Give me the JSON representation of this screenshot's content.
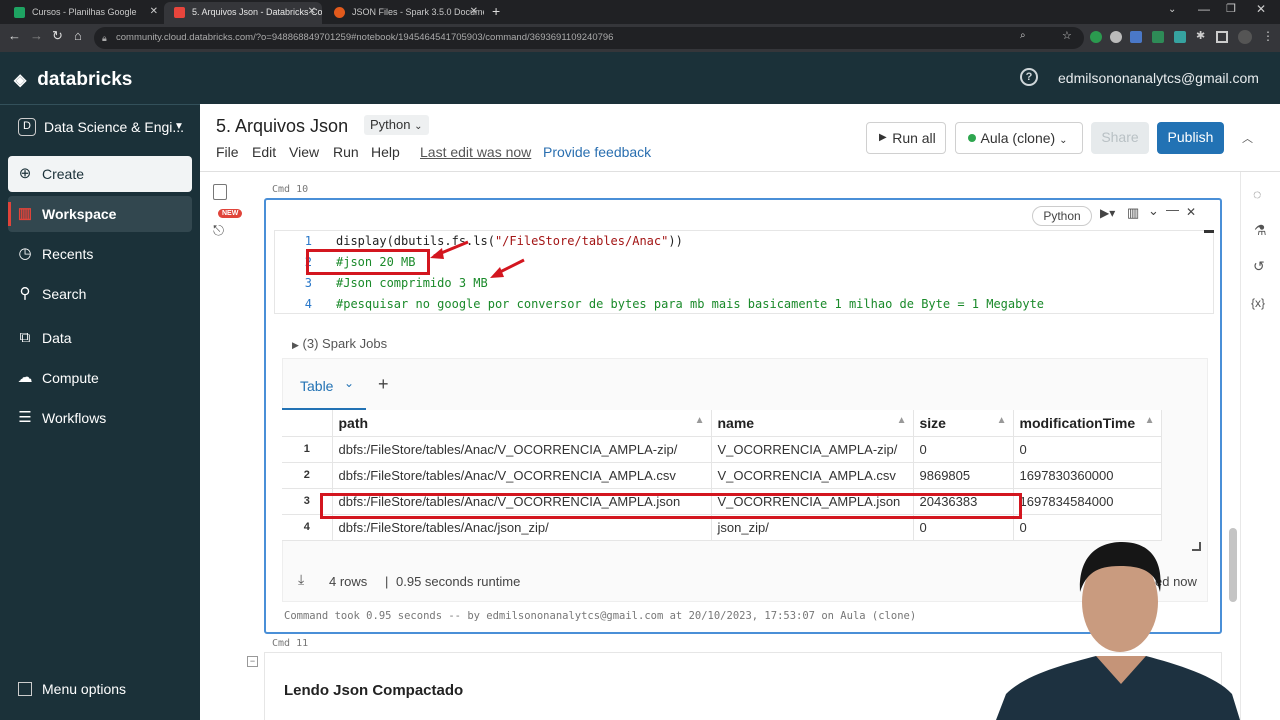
{
  "browser": {
    "tabs": [
      {
        "title": "Cursos - Planilhas Google",
        "fav_color": "#1ea362"
      },
      {
        "title": "5. Arquivos Json - Databricks Co",
        "fav_color": "#e8453c"
      },
      {
        "title": "JSON Files - Spark 3.5.0 Docume",
        "fav_color": "#e25a1c"
      }
    ],
    "url": "community.cloud.databricks.com/?o=948868849701259#notebook/1945464541705903/command/3693691109240796"
  },
  "app": {
    "brand": "databricks",
    "user_email": "edmilsononanalytcs@gmail.com",
    "workspace_switcher": "Data Science & Engi...",
    "create_label": "Create",
    "nav": [
      {
        "label": "Workspace",
        "icon": "workspace-icon"
      },
      {
        "label": "Recents",
        "icon": "clock-icon"
      },
      {
        "label": "Search",
        "icon": "search-icon"
      },
      {
        "label": "Data",
        "icon": "data-icon"
      },
      {
        "label": "Compute",
        "icon": "cloud-icon"
      },
      {
        "label": "Workflows",
        "icon": "workflows-icon"
      }
    ],
    "menu_options": "Menu options"
  },
  "notebook": {
    "title": "5. Arquivos Json",
    "language": "Python",
    "menu": [
      "File",
      "Edit",
      "View",
      "Run",
      "Help"
    ],
    "last_edit": "Last edit was now",
    "feedback": "Provide feedback",
    "run_all": "Run all",
    "cluster": "Aula (clone)",
    "share": "Share",
    "publish": "Publish",
    "new_badge": "NEW"
  },
  "cell10": {
    "cmd_label": "Cmd 10",
    "lang_badge": "Python",
    "line_numbers": [
      "1",
      "2",
      "3",
      "4"
    ],
    "code": {
      "fn": "display(dbutils.fs.ls(",
      "str": "\"/FileStore/tables/Anac\"",
      "close": "))",
      "c2": "#json 20 MB",
      "c3": "#Json comprimido 3 MB",
      "c4": "#pesquisar no google por conversor de bytes para mb mais basicamente 1 milhao de Byte = 1 Megabyte"
    },
    "spark_jobs": "(3) Spark Jobs",
    "result_tab": "Table",
    "table": {
      "columns": [
        "path",
        "name",
        "size",
        "modificationTime"
      ],
      "rows": [
        {
          "n": "1",
          "path": "dbfs:/FileStore/tables/Anac/V_OCORRENCIA_AMPLA-zip/",
          "name": "V_OCORRENCIA_AMPLA-zip/",
          "size": "0",
          "mod": "0"
        },
        {
          "n": "2",
          "path": "dbfs:/FileStore/tables/Anac/V_OCORRENCIA_AMPLA.csv",
          "name": "V_OCORRENCIA_AMPLA.csv",
          "size": "9869805",
          "mod": "1697830360000"
        },
        {
          "n": "3",
          "path": "dbfs:/FileStore/tables/Anac/V_OCORRENCIA_AMPLA.json",
          "name": "V_OCORRENCIA_AMPLA.json",
          "size": "20436383",
          "mod": "1697834584000"
        },
        {
          "n": "4",
          "path": "dbfs:/FileStore/tables/Anac/json_zip/",
          "name": "json_zip/",
          "size": "0",
          "mod": "0"
        }
      ]
    },
    "rows_count": "4 rows",
    "runtime": "0.95 seconds runtime",
    "refreshed": "ed now",
    "command_took": "Command took 0.95 seconds -- by edmilsononanalytcs@gmail.com at 20/10/2023, 17:53:07 on Aula (clone)"
  },
  "cell11": {
    "cmd_label": "Cmd 11",
    "heading": "Lendo Json Compactado"
  }
}
